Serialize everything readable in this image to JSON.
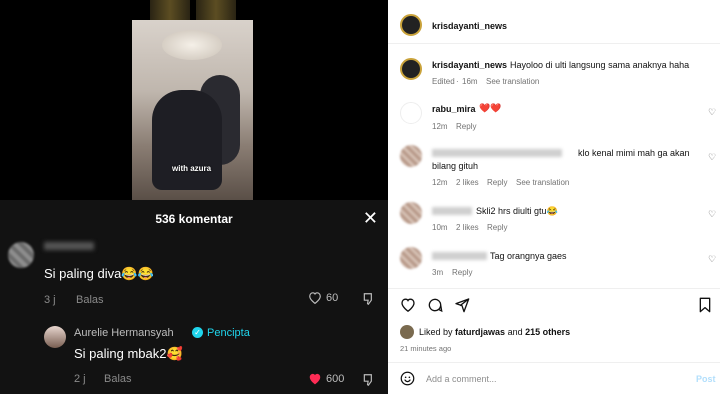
{
  "tiktok": {
    "comment_count_label": "536 komentar",
    "comments": [
      {
        "text": "Si paling diva😂😂",
        "time": "3 j",
        "reply_label": "Balas",
        "likes": "60"
      },
      {
        "username": "Aurelie Hermansyah",
        "creator_label": "Pencipta",
        "text": "Si paling mbak2🥰",
        "time": "2 j",
        "reply_label": "Balas",
        "likes": "600"
      }
    ],
    "video_caption": "with azura"
  },
  "instagram": {
    "header_username": "krisdayanti_news",
    "post": {
      "username": "krisdayanti_news",
      "caption": "Hayoloo di ulti langsung sama anaknya haha",
      "edited_label": "Edited",
      "time": "16m",
      "see_translation": "See translation"
    },
    "comments": [
      {
        "username": "rabu_mira",
        "text": "❤️❤️",
        "time": "12m",
        "reply": "Reply"
      },
      {
        "text": "klo kenal mimi mah ga akan bilang gituh",
        "time": "12m",
        "likes": "2 likes",
        "reply": "Reply",
        "see_translation": "See translation"
      },
      {
        "text": "Skli2 hrs diulti gtu😂",
        "time": "10m",
        "likes": "2 likes",
        "reply": "Reply"
      },
      {
        "text": "Tag orangnya gaes",
        "time": "3m",
        "reply": "Reply"
      }
    ],
    "liked_by_prefix": "Liked by",
    "liked_by_user": "faturdjawas",
    "liked_by_and": "and",
    "liked_by_others": "215 others",
    "post_time": "21 minutes ago",
    "add_comment_placeholder": "Add a comment...",
    "post_button": "Post"
  },
  "colors": {
    "creator_blue": "#20d5ec",
    "liked_red": "#fe2c55",
    "ig_post_blue": "#b2dffc"
  }
}
